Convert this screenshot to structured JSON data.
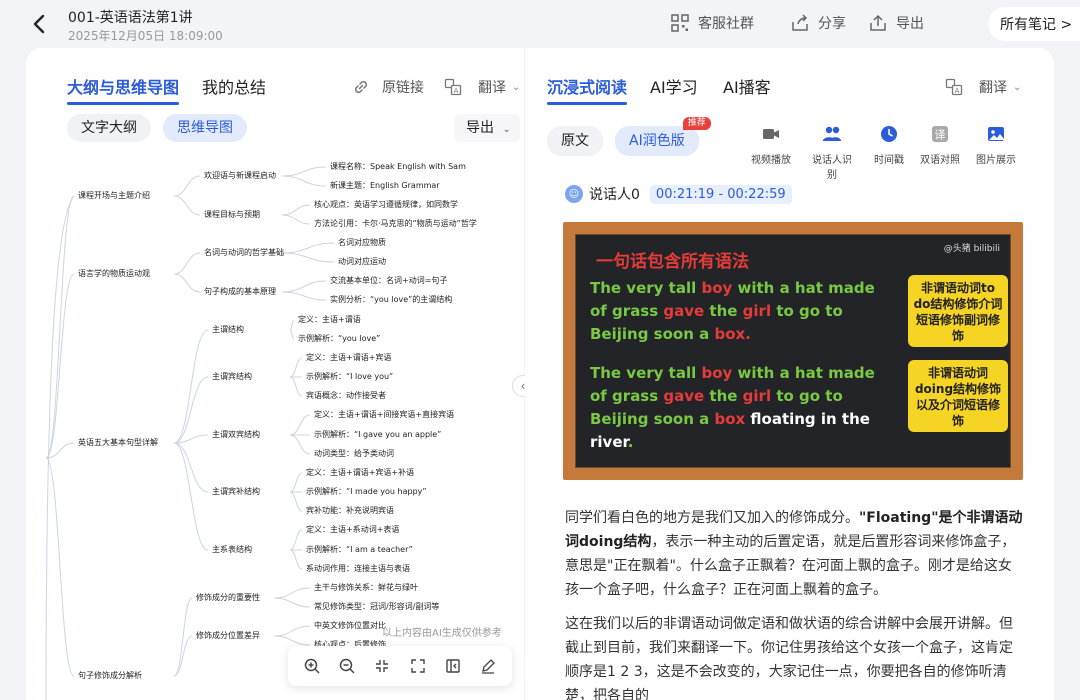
{
  "header": {
    "title": "001-英语语法第1讲",
    "date": "2025年12月05日 18:09:00",
    "community": "客服社群",
    "share": "分享",
    "export": "导出",
    "all_notes": "所有笔记 >"
  },
  "left": {
    "tab_mindmap": "大纲与思维导图",
    "tab_summary": "我的总结",
    "source_link": "原链接",
    "translate": "翻译",
    "pill_outline": "文字大纲",
    "pill_mindmap": "思维导图",
    "export_drop": "导出",
    "ai_note": "以上内容由AI生成仅供参考"
  },
  "mindmap": {
    "l1": [
      "课程开场与主题介绍",
      "语言学的物质运动观",
      "英语五大基本句型详解",
      "句子修饰成分解析"
    ],
    "l2": [
      "欢迎语与新课程启动",
      "课程目标与预期",
      "名词与动词的哲学基础",
      "句子构成的基本原理",
      "主谓结构",
      "主谓宾结构",
      "主谓双宾结构",
      "主谓宾补结构",
      "主系表结构",
      "修饰成分的重要性",
      "修饰成分位置差异"
    ],
    "l3": [
      "课程名称：Speak English with Sam",
      "新课主题：English Grammar",
      "核心观点：英语学习遵循规律，如同数学",
      "方法论引用：卡尔·马克思的“物质与运动”哲学",
      "名词对应物质",
      "动词对应运动",
      "交流基本单位：名词+动词=句子",
      "实例分析：“you love”的主谓结构",
      "定义：主语+谓语",
      "示例解析：“you love”",
      "定义：主语+谓语+宾语",
      "示例解析：“I love you”",
      "宾语概念：动作接受者",
      "定义：主语+谓语+间接宾语+直接宾语",
      "示例解析：“I gave you an apple”",
      "动词类型：给予类动词",
      "定义：主语+谓语+宾语+补语",
      "示例解析：“I made you happy”",
      "宾补功能：补充说明宾语",
      "定义：主语+系动词+表语",
      "示例解析：“I am a teacher”",
      "系动词作用：连接主语与表语",
      "主干与修饰关系：鲜花与绿叶",
      "常见修饰类型：冠词/形容词/副词等",
      "中英文修饰位置对比",
      "核心观点：后置修饰"
    ]
  },
  "right": {
    "tab_reading": "沉浸式阅读",
    "tab_ai_learn": "AI学习",
    "tab_ai_podcast": "AI播客",
    "translate": "翻译",
    "pill_original": "原文",
    "pill_polish": "AI润色版",
    "badge": "推荐",
    "features": [
      "视频播放",
      "说话人识别",
      "时间戳",
      "双语对照",
      "图片展示"
    ],
    "speaker": "说话人0",
    "time_range": "00:21:19 - 00:22:59",
    "board": {
      "watermark": "@头猪 bilibili",
      "title": "一句话包含所有语法",
      "s1a": "The very tall ",
      "s1b": "boy",
      "s1c": " with a hat made of grass ",
      "s1d": "gave",
      "s1e": " the ",
      "s1f": "girl",
      "s1g": " to go to Beijing soon  a ",
      "s1h": "box.",
      "s2a": "The very tall ",
      "s2b": "boy",
      "s2c": " with a hat made of grass ",
      "s2d": "gave",
      "s2e": " the ",
      "s2f": "girl",
      "s2g": " to go to Beijing soon  a ",
      "s2h": "box",
      "s2i": " floating in the river",
      "s2j": ".",
      "card1": "非谓语动词to do结构修饰介词短语修饰副词修饰",
      "card2": "非谓语动词doing结构修饰以及介词短语修饰"
    },
    "para1_a": "同学们看白色的地方是我们又加入的修饰成分。",
    "para1_b": "\"Floating\"是个非谓语动词doing结构",
    "para1_c": "，表示一种主动的后置定语，就是后置形容词来修饰盒子，意思是\"正在飘着\"。什么盒子正飘着？在河面上飘的盒子。刚才是给这女孩一个盒子吧，什么盒子？正在河面上飘着的盒子。",
    "para2": "这在我们以后的非谓语动词做定语和做状语的综合讲解中会展开讲解。但截止到目前，我们来翻译一下。你记住男孩给这个女孩一个盒子，这肯定顺序是1 2 3，这是不会改变的，大家记住一点，你要把各自的修饰听清楚，把各自的"
  }
}
